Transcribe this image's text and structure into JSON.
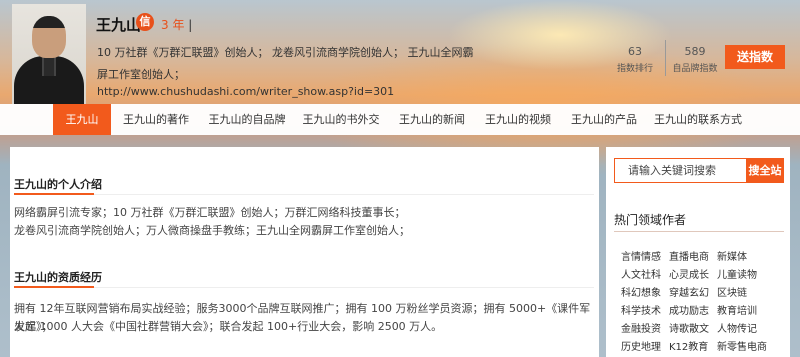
{
  "header": {
    "name": "王九山",
    "badge": "信",
    "years": "3 年",
    "years_sep": "|",
    "intro": "10 万社群《万群汇联盟》创始人；  龙卷风引流商学院创始人；  王九山全网霸屏工作室创始人；",
    "url": "http://www.chushudashi.com/writer_show.asp?id=301",
    "stats": [
      {
        "value": "63",
        "label": "指数排行"
      },
      {
        "value": "589",
        "label": "自品牌指数"
      }
    ],
    "send_button": "送指数"
  },
  "nav": {
    "items": [
      "王九山",
      "王九山的著作",
      "王九山的自品牌",
      "王九山的书外交",
      "王九山的新闻",
      "王九山的视频",
      "王九山的产品",
      "王九山的联系方式"
    ],
    "active_index": 0
  },
  "main": {
    "intro_title": "王九山的个人介绍",
    "intro_lines": [
      "网络霸屏引流专家；10 万社群《万群汇联盟》创始人；万群汇网络科技董事长；",
      "龙卷风引流商学院创始人；万人微商操盘手教练；王九山全网霸屏工作室创始人；"
    ],
    "exp_title": "王九山的资质经历",
    "exp_lines": [
      "拥有 12年互联网营销布局实战经验；服务3000个品牌互联网推广；拥有 100 万粉丝学员资源；拥有 5000+《课件军火库》；",
      "发起 1000 人大会《中国社群营销大会》；联合发起 100+行业大会，影响 2500 万人。"
    ]
  },
  "sidebar": {
    "search_placeholder": "请输入关键词搜索",
    "search_button": "搜全站",
    "hot_title": "热门领域作者",
    "tags": [
      [
        "言情情感",
        "直播电商",
        "新媒体"
      ],
      [
        "人文社科",
        "心灵成长",
        "儿童读物"
      ],
      [
        "科幻想象",
        "穿越玄幻",
        "区块链"
      ],
      [
        "科学技术",
        "成功励志",
        "教育培训"
      ],
      [
        "金融投资",
        "诗歌散文",
        "人物传记"
      ],
      [
        "历史地理",
        "K12教育",
        "新零售电商"
      ]
    ]
  },
  "colors": {
    "accent": "#f25a1c"
  }
}
